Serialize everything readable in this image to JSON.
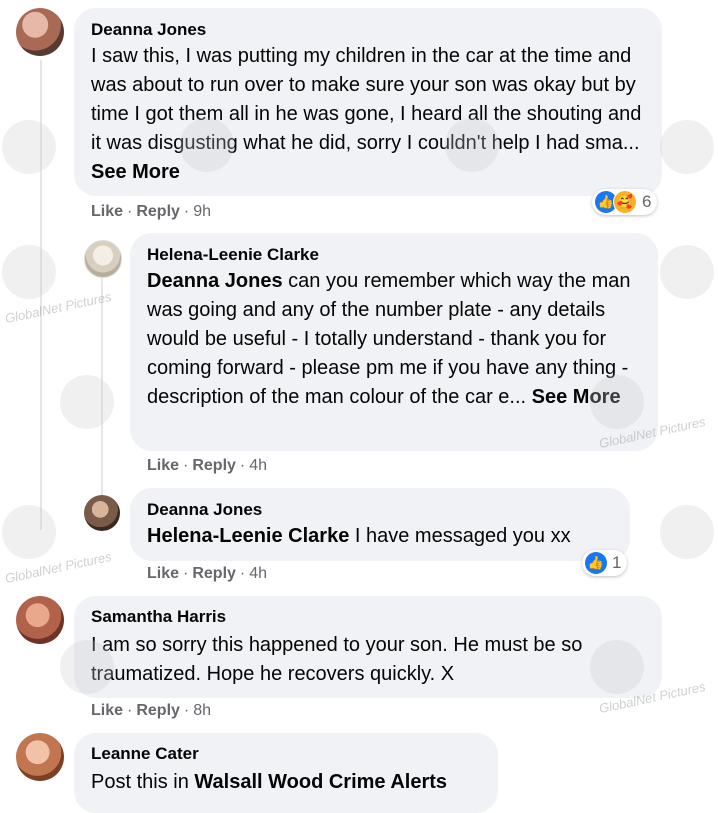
{
  "watermark": "GlobalNet Pictures",
  "comments": [
    {
      "name": "Deanna Jones",
      "text": "I saw this, I was putting my children in the car at the time and was about to run over to make sure your son was okay but by time I got them all in he was gone, I heard all the shouting and it was disgusting what he did, sorry I couldn't help I had sma...",
      "see_more": "See More",
      "like": "Like",
      "reply": "Reply",
      "time": "9h",
      "reaction_count": "6"
    },
    {
      "name": "Helena-Leenie Clarke",
      "mention": "Deanna Jones",
      "text": "can you remember which way the man was going and any of the number plate - any details would be useful - I totally understand - thank you for coming forward - please pm me if you have any thing - description of the man colour of the car e...",
      "see_more": "See More",
      "like": "Like",
      "reply": "Reply",
      "time": "4h"
    },
    {
      "name": "Deanna Jones",
      "mention": "Helena-Leenie Clarke",
      "text": "I have messaged you xx",
      "like": "Like",
      "reply": "Reply",
      "time": "4h",
      "reaction_count": "1"
    },
    {
      "name": "Samantha Harris",
      "text": "I am so sorry this happened to your son. He must be so traumatized. Hope he recovers quickly. X",
      "like": "Like",
      "reply": "Reply",
      "time": "8h"
    },
    {
      "name": "Leanne Cater",
      "text": "Post this in",
      "mention": "Walsall Wood Crime Alerts"
    }
  ],
  "separator": "·",
  "icons": {
    "like_reaction": "thumbs-up-icon",
    "care_reaction": "care-emoji-icon"
  }
}
